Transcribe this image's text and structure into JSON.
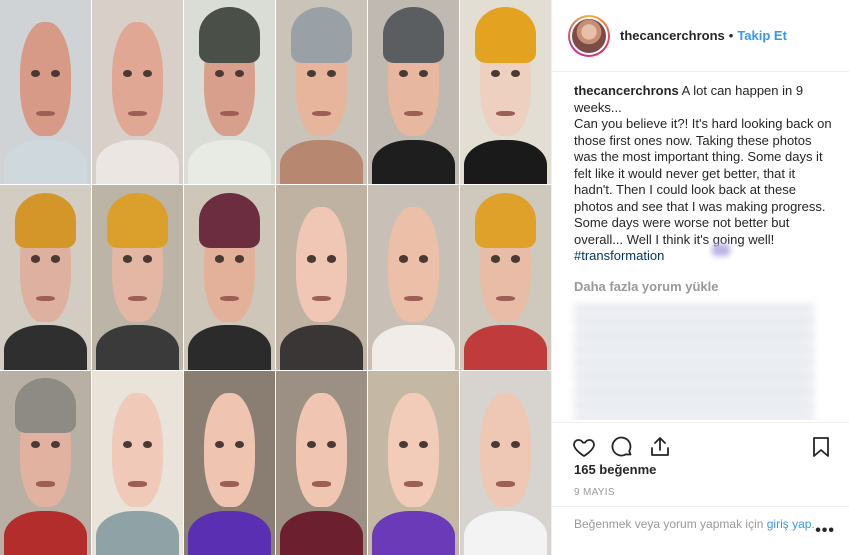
{
  "post": {
    "username": "thecancerchrons",
    "separator": "•",
    "follow_label": "Takip Et"
  },
  "caption": {
    "username": "thecancerchrons",
    "text": " A lot can happen in 9 weeks...\nCan you believe it?! It's hard looking back on those first ones now. Taking these photos was the most important thing. Some days it felt like it would never get better, that it hadn't. Then I could look back at these photos and see that I was making progress. Some days were worse not better but overall... Well I think it's going well!\n",
    "hashtag": "#transformation"
  },
  "comments": {
    "load_more_label": "Daha fazla yorum yükle"
  },
  "actions": {
    "like_icon": "heart-icon",
    "comment_icon": "comment-icon",
    "share_icon": "share-icon",
    "save_icon": "bookmark-icon"
  },
  "likes_label": "165 beğenme",
  "date_label": "9 MAYIS",
  "footer": {
    "prompt": "Beğenmek veya yorum yapmak için ",
    "login_label": "giriş yap",
    "suffix": ".",
    "more_icon": "more-options-icon"
  },
  "colors": {
    "accent": "#3897f0",
    "text": "#262626",
    "muted": "#999999",
    "hashtag": "#003569"
  }
}
